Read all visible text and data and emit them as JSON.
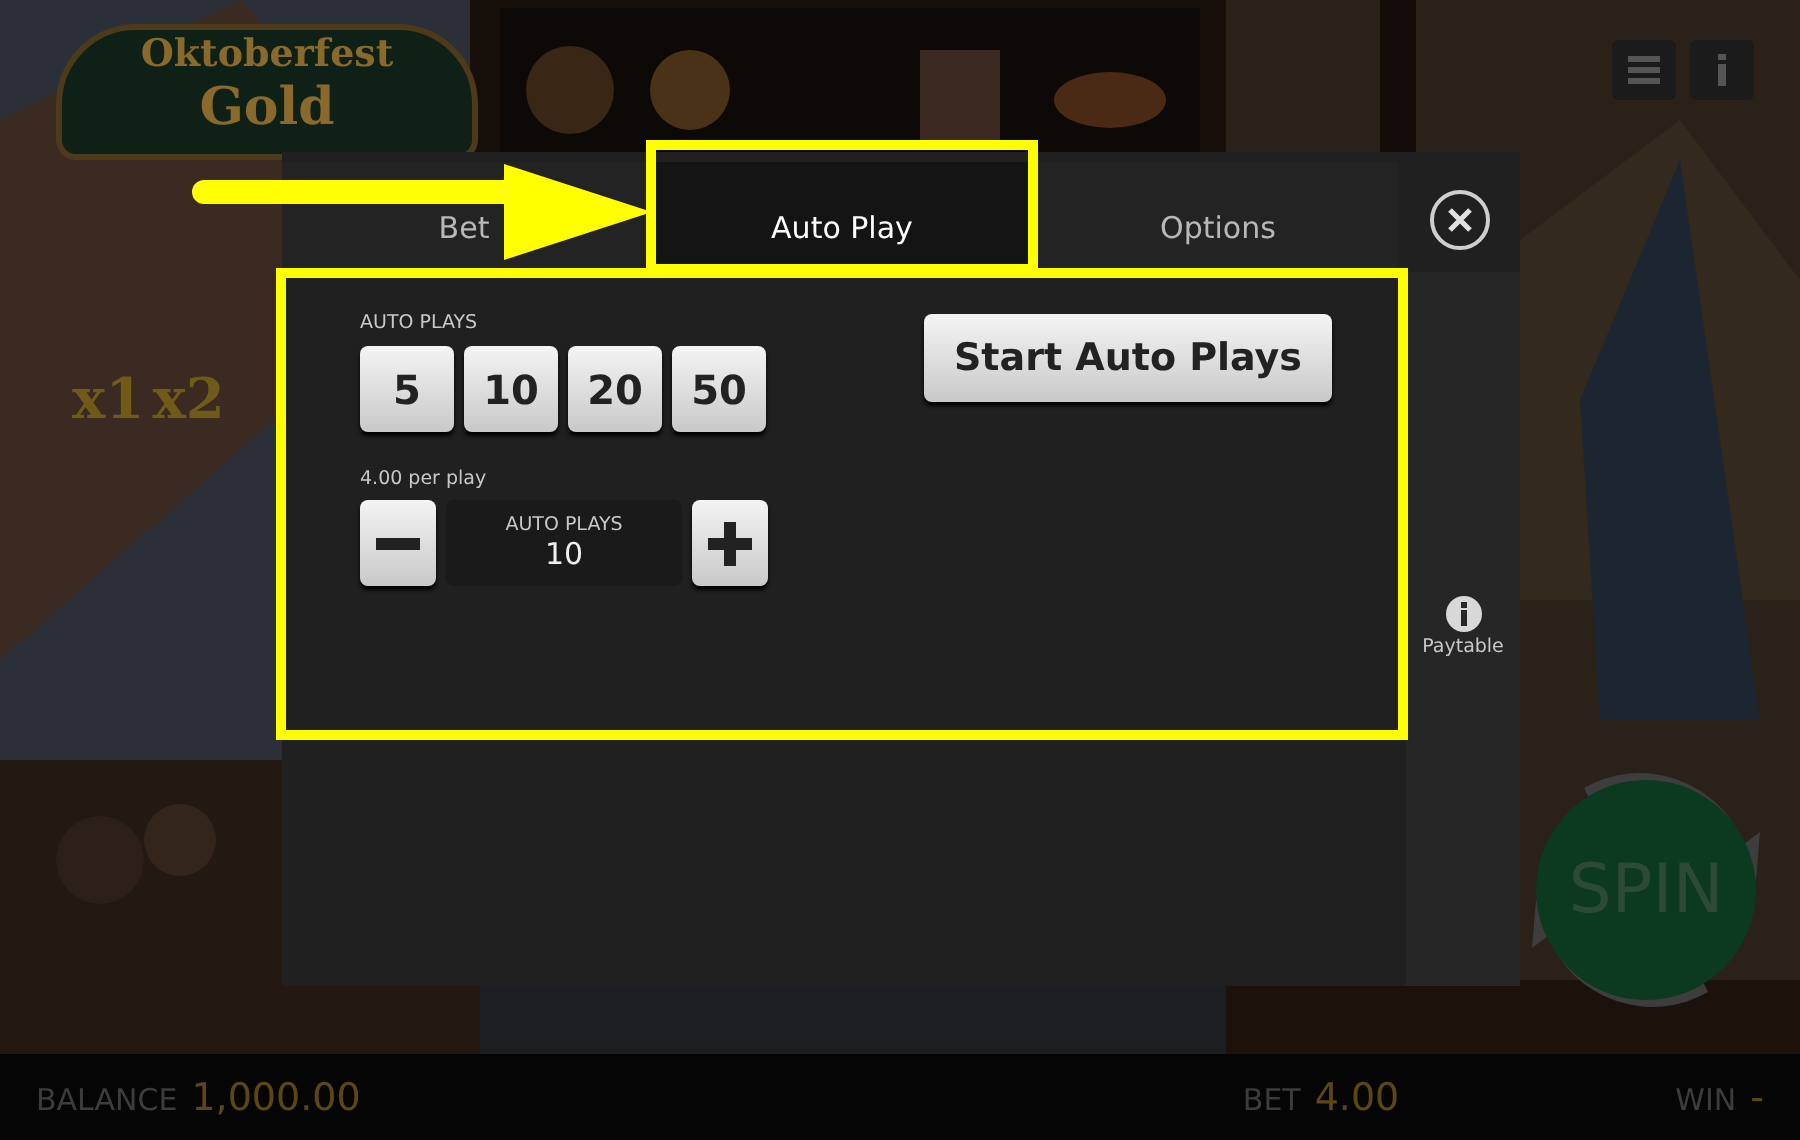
{
  "game": {
    "logo": [
      "Oktoberfest",
      "Gold"
    ],
    "multipliers": [
      "x1",
      "x2"
    ],
    "spin_button": "SPIN"
  },
  "dialog": {
    "tabs": [
      {
        "label": "Bet",
        "selected": false
      },
      {
        "label": "Auto Play",
        "selected": true
      },
      {
        "label": "Options",
        "selected": false
      }
    ],
    "auto_plays": {
      "label": "AUTO PLAYS",
      "presets": [
        "5",
        "10",
        "20",
        "50"
      ],
      "per_play": "4.00 per play",
      "stepper": {
        "label": "AUTO PLAYS",
        "value": "10"
      }
    },
    "start_button": "Start Auto Plays",
    "side": {
      "paytable": "Paytable"
    }
  },
  "status_bar": [
    {
      "label": "BALANCE",
      "value": "1,000.00"
    },
    {
      "label": "BET",
      "value": "4.00"
    },
    {
      "label": "WIN",
      "value": "-"
    }
  ]
}
